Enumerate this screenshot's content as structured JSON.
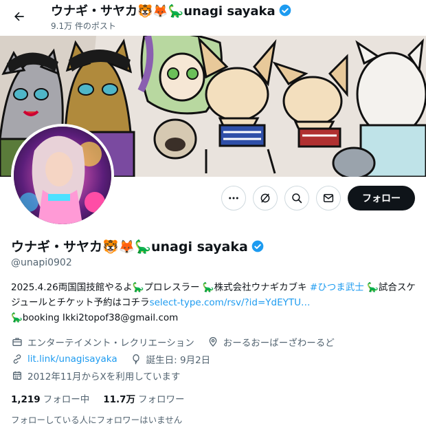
{
  "header": {
    "title": "ウナギ・サヤカ🐯🦊🦕unagi sayaka",
    "post_count": "9.1万 件のポスト"
  },
  "profile": {
    "display_name": "ウナギ・サヤカ🐯🦊🦕unagi sayaka",
    "handle": "@unapi0902",
    "bio_line1_text": "2025.4.26両国国技館やるよ🦕プロレスラー 🦕株式会社ウナギカブキ ",
    "bio_hashtag": "#ひつま武士",
    "bio_line2_text": " 🦕試合スケジュールとチケット予約はコチラ",
    "bio_link": "select-type.com/rsv/?id=YdEYTU…",
    "bio_line3_text": "🦕booking Ikki2topof38@gmail.com",
    "category": "エンターテイメント・レクリエーション",
    "location": "おーるおーばーざわーるど",
    "website": "lit.link/unagisayaka",
    "birthday": "誕生日: 9月2日",
    "joined": "2012年11月からXを利用しています",
    "following_count": "1,219",
    "following_label": "フォロー中",
    "followers_count": "11.7万",
    "followers_label": "フォロワー",
    "followers_note": "フォローしている人にフォロワーはいません"
  },
  "actions": {
    "follow_label": "フォロー"
  },
  "colors": {
    "accent": "#1d9bf0",
    "text": "#0f1419",
    "secondary": "#536471",
    "follow_bg": "#0f1419"
  },
  "icons": [
    "back-arrow-icon",
    "verified-badge-icon",
    "more-icon",
    "grok-icon",
    "search-icon",
    "message-icon",
    "briefcase-icon",
    "location-icon",
    "link-icon",
    "balloon-icon",
    "calendar-icon"
  ]
}
